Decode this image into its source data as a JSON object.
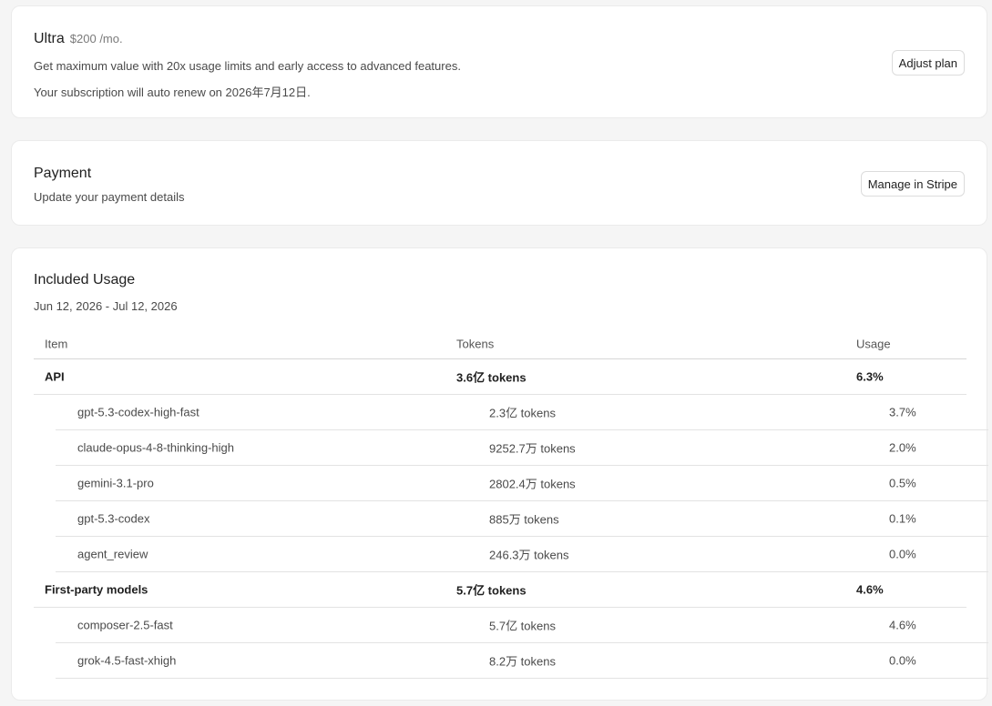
{
  "plan": {
    "name": "Ultra",
    "price": "$200 /mo.",
    "description": "Get maximum value with 20x usage limits and early access to advanced features.",
    "renewal": "Your subscription will auto renew on 2026年7月12日.",
    "button": "Adjust plan"
  },
  "payment": {
    "title": "Payment",
    "description": "Update your payment details",
    "button": "Manage in Stripe"
  },
  "usage": {
    "title": "Included Usage",
    "period": "Jun 12, 2026 - Jul 12, 2026",
    "columns": {
      "item": "Item",
      "tokens": "Tokens",
      "usage": "Usage"
    },
    "rows": [
      {
        "type": "group",
        "item": "API",
        "tokens": "3.6亿 tokens",
        "usage": "6.3%"
      },
      {
        "type": "sub",
        "item": "gpt-5.3-codex-high-fast",
        "tokens": "2.3亿 tokens",
        "usage": "3.7%"
      },
      {
        "type": "sub",
        "item": "claude-opus-4-8-thinking-high",
        "tokens": "9252.7万 tokens",
        "usage": "2.0%"
      },
      {
        "type": "sub",
        "item": "gemini-3.1-pro",
        "tokens": "2802.4万 tokens",
        "usage": "0.5%"
      },
      {
        "type": "sub",
        "item": "gpt-5.3-codex",
        "tokens": "885万 tokens",
        "usage": "0.1%"
      },
      {
        "type": "sub",
        "item": "agent_review",
        "tokens": "246.3万 tokens",
        "usage": "0.0%"
      },
      {
        "type": "group",
        "item": "First-party models",
        "tokens": "5.7亿 tokens",
        "usage": "4.6%"
      },
      {
        "type": "sub",
        "item": "composer-2.5-fast",
        "tokens": "5.7亿 tokens",
        "usage": "4.6%"
      },
      {
        "type": "sub",
        "item": "grok-4.5-fast-xhigh",
        "tokens": "8.2万 tokens",
        "usage": "0.0%"
      }
    ]
  }
}
